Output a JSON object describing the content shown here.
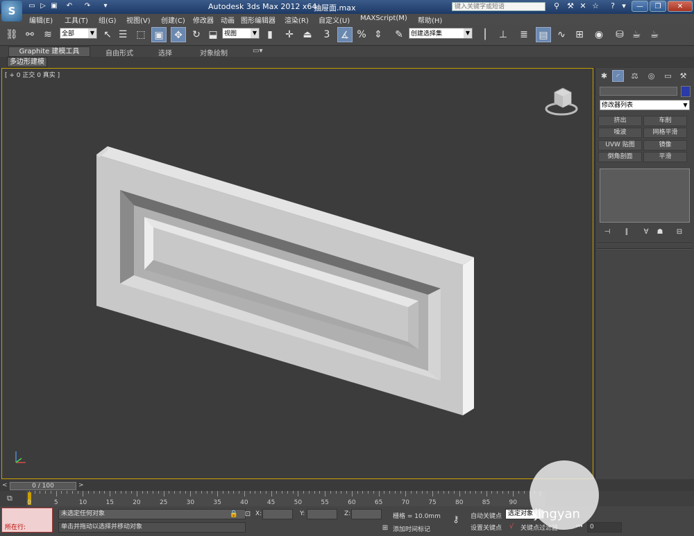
{
  "titlebar": {
    "logo_glyph": "S",
    "app_title": "Autodesk 3ds Max  2012 x64",
    "file_name": "抽屉面.max",
    "search_placeholder": "键入关键字或短语",
    "window_buttons": [
      "—",
      "❐",
      "✕"
    ]
  },
  "menu": {
    "items": [
      "编辑(E)",
      "工具(T)",
      "组(G)",
      "视图(V)",
      "创建(C)",
      "修改器",
      "动画",
      "图形编辑器",
      "渲染(R)",
      "自定义(U)",
      "MAXScript(M)",
      "帮助(H)"
    ]
  },
  "toolbar": {
    "selection_filter": "全部",
    "ref_coord": "视图",
    "named_selection": "创建选择集"
  },
  "ribbon": {
    "tabs": [
      "Graphite 建模工具",
      "自由形式",
      "选择",
      "对象绘制"
    ],
    "sub_tab": "多边形建模"
  },
  "viewport": {
    "label": "[ + 0 正交 0 真实 ]",
    "border_color": "#c9a000"
  },
  "command_panel": {
    "modifier_list": "修改器列表",
    "modifier_buttons": [
      "挤出",
      "车削",
      "噪波",
      "网格平滑",
      "UVW 贴图",
      "镜像",
      "倒角剖面",
      "平滑"
    ],
    "object_color": "#2a3aa8"
  },
  "timeline": {
    "frame_display": "0 / 100",
    "prev_arrow": "<",
    "next_arrow": ">",
    "ticks": [
      "0",
      "5",
      "10",
      "15",
      "20",
      "25",
      "30",
      "35",
      "40",
      "45",
      "50",
      "55",
      "60",
      "65",
      "70",
      "75",
      "80",
      "85",
      "90"
    ]
  },
  "status": {
    "script_label": "所在行:",
    "prompt1": "未选定任何对象",
    "prompt2": "单击并拖动以选择并移动对象",
    "x_label": "X:",
    "y_label": "Y:",
    "z_label": "Z:",
    "grid": "栅格 = 10.0mm",
    "add_time_tag": "添加时间标记",
    "auto_key": "自动关键点",
    "set_key": "设置关键点",
    "selected_dropdown": "选定对象",
    "key_filters": "关键点过滤器...",
    "frame_value": "0"
  },
  "watermark": {
    "text": "jingyan"
  }
}
